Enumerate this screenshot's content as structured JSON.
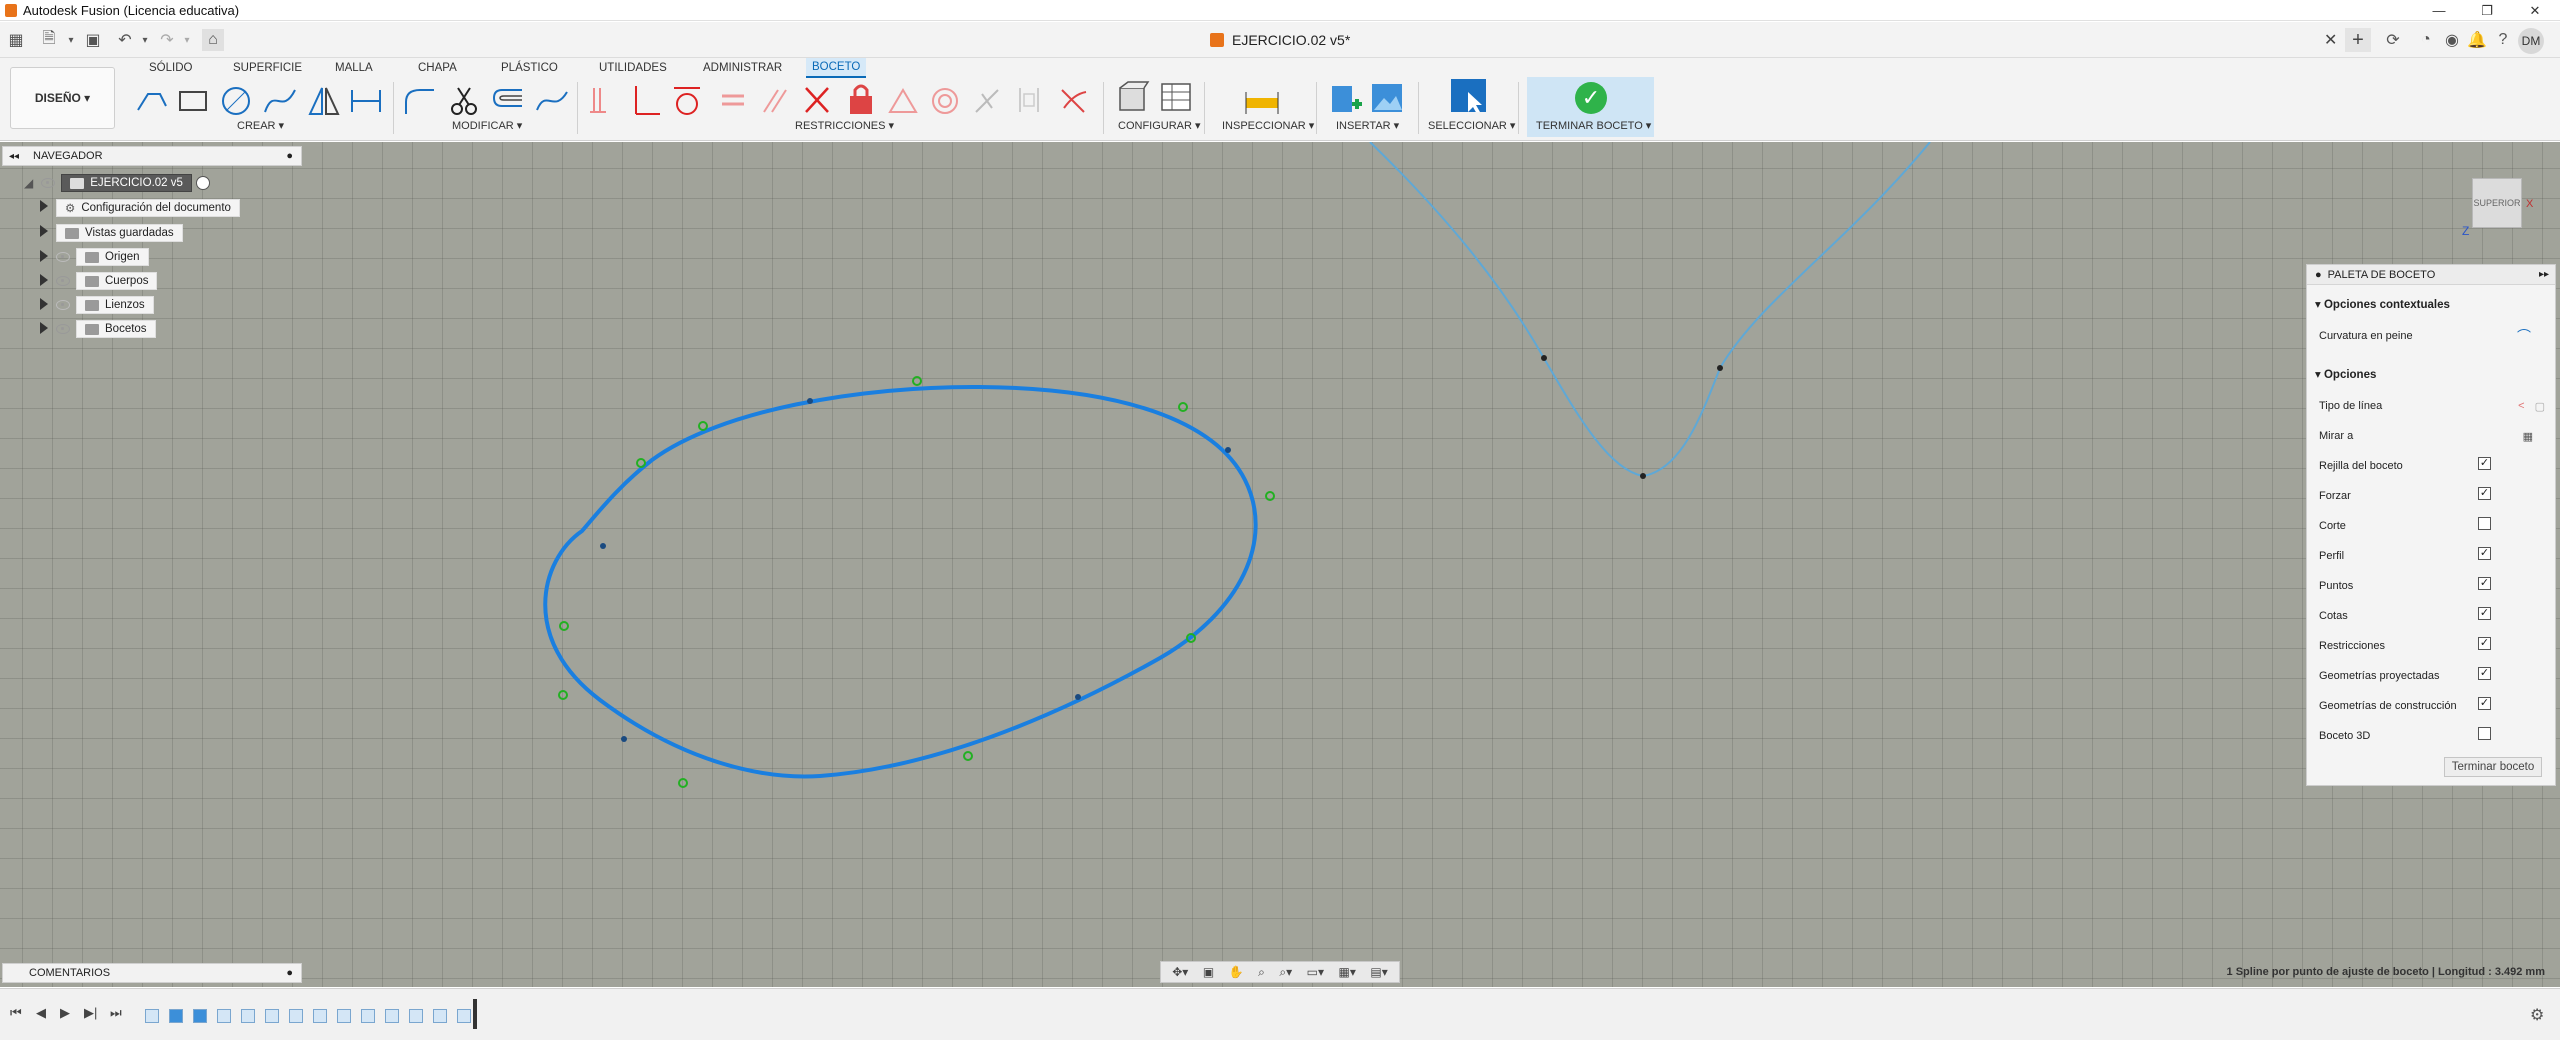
{
  "window": {
    "title": "Autodesk Fusion (Licencia educativa)",
    "controls": [
      "—",
      "❐",
      "✕"
    ]
  },
  "document": {
    "tab_title": "EJERCICIO.02 v5*",
    "user_initials": "DM"
  },
  "ribbon": {
    "workspace": "DISEÑO ▾",
    "tabs": [
      "SÓLIDO",
      "SUPERFICIE",
      "MALLA",
      "CHAPA",
      "PLÁSTICO",
      "UTILIDADES",
      "ADMINISTRAR",
      "BOCETO"
    ],
    "active_tab": "BOCETO",
    "groups": {
      "create": "CREAR ▾",
      "modify": "MODIFICAR ▾",
      "constraints": "RESTRICCIONES ▾",
      "configure": "CONFIGURAR ▾",
      "inspect": "INSPECCIONAR ▾",
      "insert": "INSERTAR ▾",
      "select": "SELECCIONAR ▾",
      "finish": "TERMINAR BOCETO ▾"
    }
  },
  "navigator": {
    "header": "NAVEGADOR",
    "root": "EJERCICIO.02 v5",
    "items": [
      "Configuración del documento",
      "Vistas guardadas",
      "Origen",
      "Cuerpos",
      "Lienzos",
      "Bocetos"
    ]
  },
  "viewcube": {
    "label": "SUPERIOR",
    "axis_z": "Z",
    "axis_x": "X"
  },
  "palette": {
    "title": "PALETA DE BOCETO",
    "contextual_header": "Opciones contextuales",
    "contextual_item": "Curvatura en peine",
    "options_header": "Opciones",
    "line_type": "Tipo de línea",
    "look_at": "Mirar a",
    "options": [
      {
        "label": "Rejilla del boceto",
        "checked": true
      },
      {
        "label": "Forzar",
        "checked": true
      },
      {
        "label": "Corte",
        "checked": false
      },
      {
        "label": "Perfil",
        "checked": true
      },
      {
        "label": "Puntos",
        "checked": true
      },
      {
        "label": "Cotas",
        "checked": true
      },
      {
        "label": "Restricciones",
        "checked": true
      },
      {
        "label": "Geometrías proyectadas",
        "checked": true
      },
      {
        "label": "Geometrías de construcción",
        "checked": true
      },
      {
        "label": "Boceto 3D",
        "checked": false
      }
    ],
    "finish_button": "Terminar boceto"
  },
  "comments": {
    "label": "COMENTARIOS"
  },
  "status": {
    "selection": "1 Spline por punto de ajuste de boceto | Longitud : 3.492 mm"
  },
  "colors": {
    "spline_selected": "#1a7fe0",
    "spline_other": "#5fa8d6",
    "handle_green": "#2faa2f",
    "grid_bg": "#a1a39a",
    "accent": "#0a6ab7"
  },
  "icons": [
    "apps-grid-icon",
    "file-icon",
    "save-icon",
    "undo-icon",
    "redo-icon",
    "home-icon",
    "refresh-icon",
    "bell-icon",
    "help-icon",
    "globe-icon"
  ]
}
